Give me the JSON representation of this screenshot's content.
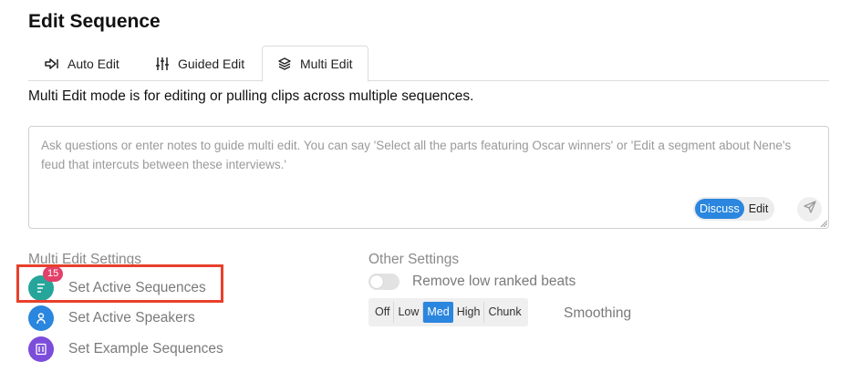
{
  "page": {
    "title": "Edit Sequence"
  },
  "tabs": [
    {
      "label": "Auto Edit",
      "icon": "arrow-right-icon"
    },
    {
      "label": "Guided Edit",
      "icon": "sliders-icon"
    },
    {
      "label": "Multi Edit",
      "icon": "layers-icon",
      "active": true
    }
  ],
  "description": "Multi Edit mode is for editing or pulling clips across multiple sequences.",
  "prompt": {
    "placeholder": "Ask questions or enter notes to guide multi edit. You can say 'Select all the parts featuring Oscar winners' or 'Edit a segment about Nene's feud that intercuts between these interviews.'",
    "value": "",
    "modes": [
      "Discuss",
      "Edit"
    ],
    "selected_mode": "Discuss"
  },
  "multi_edit_settings": {
    "label": "Multi Edit Settings",
    "items": [
      {
        "label": "Set Active Sequences",
        "badge": "15",
        "icon": "list-icon",
        "color": "#26a69a"
      },
      {
        "label": "Set Active Speakers",
        "icon": "person-icon",
        "color": "#2a86de"
      },
      {
        "label": "Set Example Sequences",
        "icon": "sequence-icon",
        "color": "#7c4ddb"
      }
    ]
  },
  "other_settings": {
    "label": "Other Settings",
    "toggle_label": "Remove low ranked beats",
    "toggle_on": false,
    "smoothing_options": [
      "Off",
      "Low",
      "Med",
      "High",
      "Chunk"
    ],
    "smoothing_selected": "Med",
    "smoothing_label": "Smoothing"
  },
  "colors": {
    "accent": "#2a86de",
    "badge": "#e2406a",
    "highlight": "#e8402b"
  }
}
